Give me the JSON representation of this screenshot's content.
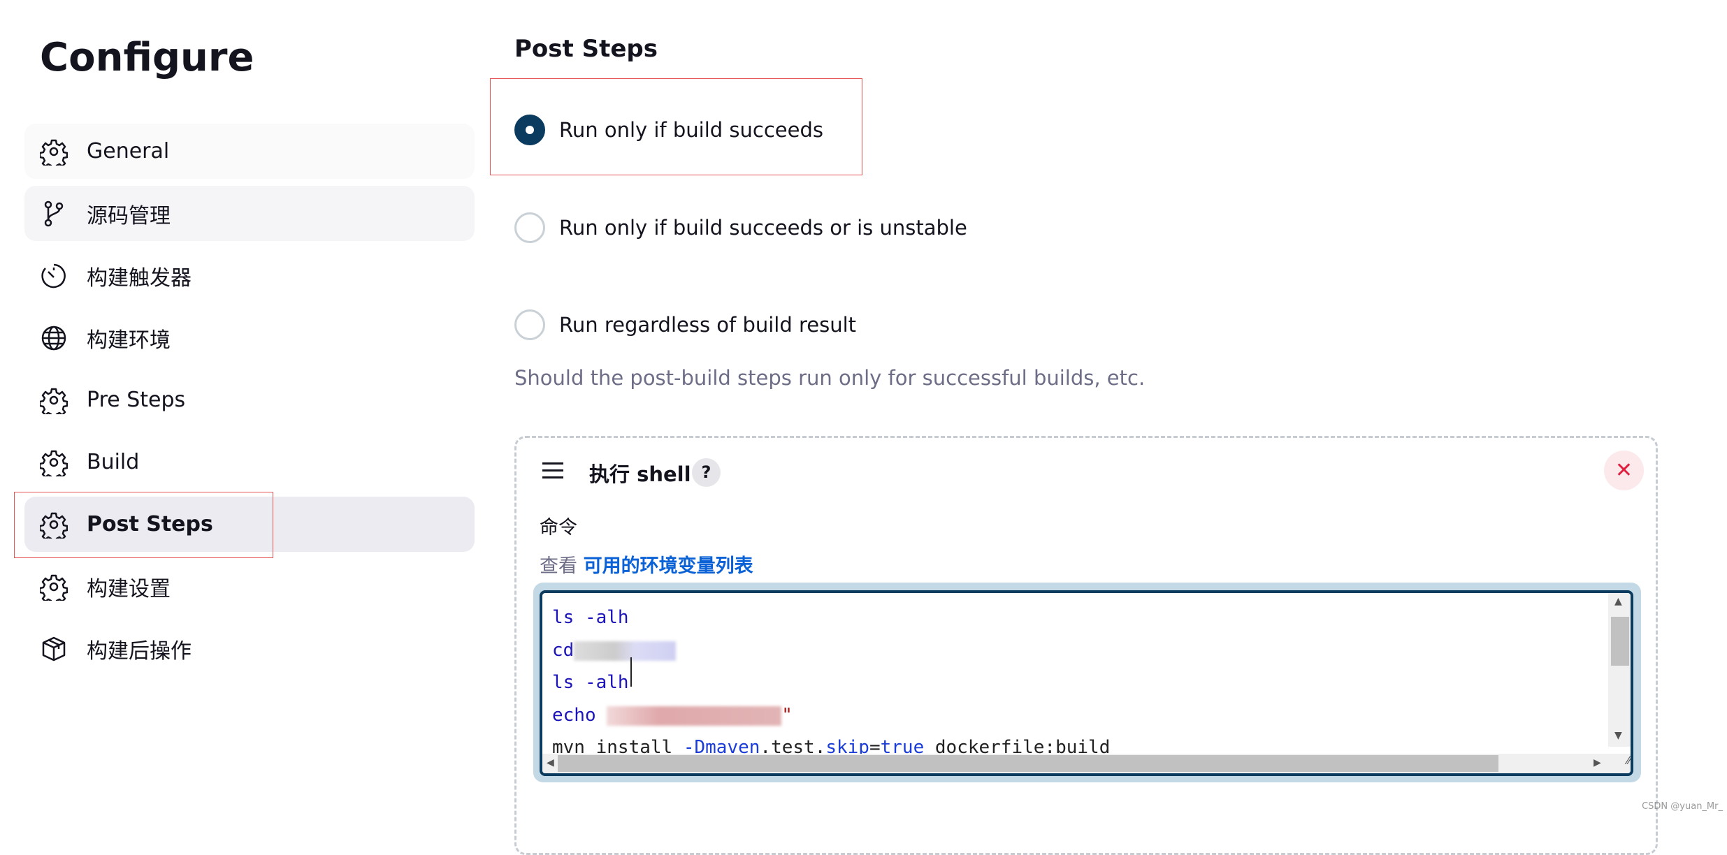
{
  "sidebar": {
    "title": "Configure",
    "items": [
      {
        "label": "General",
        "icon": "gear-icon"
      },
      {
        "label": "源码管理",
        "icon": "branch-icon"
      },
      {
        "label": "构建触发器",
        "icon": "timer-icon"
      },
      {
        "label": "构建环境",
        "icon": "globe-icon"
      },
      {
        "label": "Pre Steps",
        "icon": "gear-icon"
      },
      {
        "label": "Build",
        "icon": "gear-icon"
      },
      {
        "label": "Post Steps",
        "icon": "gear-icon",
        "active": true
      },
      {
        "label": "构建设置",
        "icon": "gear-icon"
      },
      {
        "label": "构建后操作",
        "icon": "package-icon"
      }
    ]
  },
  "main": {
    "section_title": "Post Steps",
    "options": [
      {
        "label": "Run only if build succeeds",
        "selected": true
      },
      {
        "label": "Run only if build succeeds or is unstable",
        "selected": false
      },
      {
        "label": "Run regardless of build result",
        "selected": false
      }
    ],
    "help_text": "Should the post-build steps run only for successful builds, etc.",
    "step": {
      "title": "执行 shell",
      "help": "?",
      "close": "✕",
      "command_label": "命令",
      "env_prefix": "查看",
      "env_link": "可用的环境变量列表",
      "code": {
        "l1": "ls -alh",
        "l2": "cd",
        "l3": "ls -alh",
        "l4": "echo",
        "l4_tail": "\"",
        "l5": [
          "mvn install ",
          "-Dmaven",
          ".test.",
          "skip",
          "=",
          "true",
          " dockerfile:build"
        ]
      }
    }
  },
  "colors": {
    "accent": "#0b3b5e",
    "link": "#0b62d6",
    "highlight": "#e65454"
  },
  "watermark": "CSDN @yuan_Mr_"
}
